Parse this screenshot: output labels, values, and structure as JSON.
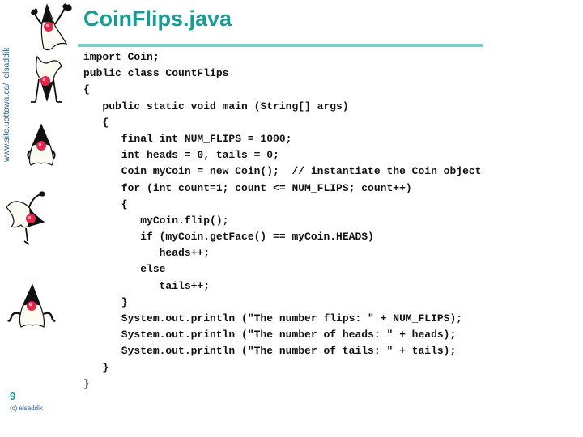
{
  "slide": {
    "title": "CoinFlips.java",
    "side_text": "www.site.uottawa.ca/~elsaddik",
    "slide_number": "9",
    "copyright": "(c) elsaddik",
    "colors": {
      "title": "#1a9a94",
      "rule": "#7ecdcf",
      "side_text": "#2a5f96",
      "duke_body": "#fbfbf3",
      "duke_nose": "#e0284a"
    },
    "mascots": [
      "duke-waving-icon",
      "duke-upside-down-icon",
      "duke-hands-on-hips-icon",
      "duke-cartwheel-icon",
      "duke-arms-out-icon"
    ]
  },
  "code": {
    "lines": [
      "import Coin;",
      "public class CountFlips",
      "{",
      "   public static void main (String[] args)",
      "   {",
      "      final int NUM_FLIPS = 1000;",
      "      int heads = 0, tails = 0;",
      "      Coin myCoin = new Coin();  // instantiate the Coin object",
      "      for (int count=1; count <= NUM_FLIPS; count++)",
      "      {",
      "         myCoin.flip();",
      "         if (myCoin.getFace() == myCoin.HEADS)",
      "            heads++;",
      "         else",
      "            tails++;",
      "      }",
      "      System.out.println (\"The number flips: \" + NUM_FLIPS);",
      "      System.out.println (\"The number of heads: \" + heads);",
      "      System.out.println (\"The number of tails: \" + tails);",
      "   }",
      "}"
    ]
  }
}
